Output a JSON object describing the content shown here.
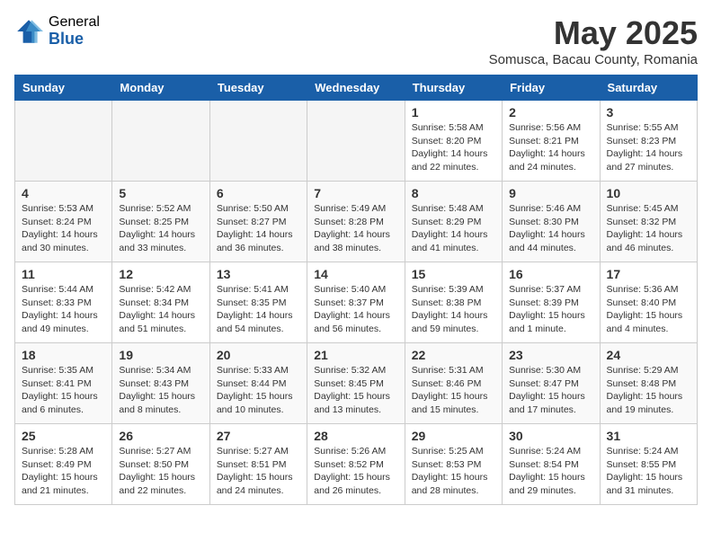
{
  "logo": {
    "general": "General",
    "blue": "Blue"
  },
  "title": {
    "month_year": "May 2025",
    "location": "Somusca, Bacau County, Romania"
  },
  "days_of_week": [
    "Sunday",
    "Monday",
    "Tuesday",
    "Wednesday",
    "Thursday",
    "Friday",
    "Saturday"
  ],
  "weeks": [
    [
      {
        "day": "",
        "info": ""
      },
      {
        "day": "",
        "info": ""
      },
      {
        "day": "",
        "info": ""
      },
      {
        "day": "",
        "info": ""
      },
      {
        "day": "1",
        "info": "Sunrise: 5:58 AM\nSunset: 8:20 PM\nDaylight: 14 hours\nand 22 minutes."
      },
      {
        "day": "2",
        "info": "Sunrise: 5:56 AM\nSunset: 8:21 PM\nDaylight: 14 hours\nand 24 minutes."
      },
      {
        "day": "3",
        "info": "Sunrise: 5:55 AM\nSunset: 8:23 PM\nDaylight: 14 hours\nand 27 minutes."
      }
    ],
    [
      {
        "day": "4",
        "info": "Sunrise: 5:53 AM\nSunset: 8:24 PM\nDaylight: 14 hours\nand 30 minutes."
      },
      {
        "day": "5",
        "info": "Sunrise: 5:52 AM\nSunset: 8:25 PM\nDaylight: 14 hours\nand 33 minutes."
      },
      {
        "day": "6",
        "info": "Sunrise: 5:50 AM\nSunset: 8:27 PM\nDaylight: 14 hours\nand 36 minutes."
      },
      {
        "day": "7",
        "info": "Sunrise: 5:49 AM\nSunset: 8:28 PM\nDaylight: 14 hours\nand 38 minutes."
      },
      {
        "day": "8",
        "info": "Sunrise: 5:48 AM\nSunset: 8:29 PM\nDaylight: 14 hours\nand 41 minutes."
      },
      {
        "day": "9",
        "info": "Sunrise: 5:46 AM\nSunset: 8:30 PM\nDaylight: 14 hours\nand 44 minutes."
      },
      {
        "day": "10",
        "info": "Sunrise: 5:45 AM\nSunset: 8:32 PM\nDaylight: 14 hours\nand 46 minutes."
      }
    ],
    [
      {
        "day": "11",
        "info": "Sunrise: 5:44 AM\nSunset: 8:33 PM\nDaylight: 14 hours\nand 49 minutes."
      },
      {
        "day": "12",
        "info": "Sunrise: 5:42 AM\nSunset: 8:34 PM\nDaylight: 14 hours\nand 51 minutes."
      },
      {
        "day": "13",
        "info": "Sunrise: 5:41 AM\nSunset: 8:35 PM\nDaylight: 14 hours\nand 54 minutes."
      },
      {
        "day": "14",
        "info": "Sunrise: 5:40 AM\nSunset: 8:37 PM\nDaylight: 14 hours\nand 56 minutes."
      },
      {
        "day": "15",
        "info": "Sunrise: 5:39 AM\nSunset: 8:38 PM\nDaylight: 14 hours\nand 59 minutes."
      },
      {
        "day": "16",
        "info": "Sunrise: 5:37 AM\nSunset: 8:39 PM\nDaylight: 15 hours\nand 1 minute."
      },
      {
        "day": "17",
        "info": "Sunrise: 5:36 AM\nSunset: 8:40 PM\nDaylight: 15 hours\nand 4 minutes."
      }
    ],
    [
      {
        "day": "18",
        "info": "Sunrise: 5:35 AM\nSunset: 8:41 PM\nDaylight: 15 hours\nand 6 minutes."
      },
      {
        "day": "19",
        "info": "Sunrise: 5:34 AM\nSunset: 8:43 PM\nDaylight: 15 hours\nand 8 minutes."
      },
      {
        "day": "20",
        "info": "Sunrise: 5:33 AM\nSunset: 8:44 PM\nDaylight: 15 hours\nand 10 minutes."
      },
      {
        "day": "21",
        "info": "Sunrise: 5:32 AM\nSunset: 8:45 PM\nDaylight: 15 hours\nand 13 minutes."
      },
      {
        "day": "22",
        "info": "Sunrise: 5:31 AM\nSunset: 8:46 PM\nDaylight: 15 hours\nand 15 minutes."
      },
      {
        "day": "23",
        "info": "Sunrise: 5:30 AM\nSunset: 8:47 PM\nDaylight: 15 hours\nand 17 minutes."
      },
      {
        "day": "24",
        "info": "Sunrise: 5:29 AM\nSunset: 8:48 PM\nDaylight: 15 hours\nand 19 minutes."
      }
    ],
    [
      {
        "day": "25",
        "info": "Sunrise: 5:28 AM\nSunset: 8:49 PM\nDaylight: 15 hours\nand 21 minutes."
      },
      {
        "day": "26",
        "info": "Sunrise: 5:27 AM\nSunset: 8:50 PM\nDaylight: 15 hours\nand 22 minutes."
      },
      {
        "day": "27",
        "info": "Sunrise: 5:27 AM\nSunset: 8:51 PM\nDaylight: 15 hours\nand 24 minutes."
      },
      {
        "day": "28",
        "info": "Sunrise: 5:26 AM\nSunset: 8:52 PM\nDaylight: 15 hours\nand 26 minutes."
      },
      {
        "day": "29",
        "info": "Sunrise: 5:25 AM\nSunset: 8:53 PM\nDaylight: 15 hours\nand 28 minutes."
      },
      {
        "day": "30",
        "info": "Sunrise: 5:24 AM\nSunset: 8:54 PM\nDaylight: 15 hours\nand 29 minutes."
      },
      {
        "day": "31",
        "info": "Sunrise: 5:24 AM\nSunset: 8:55 PM\nDaylight: 15 hours\nand 31 minutes."
      }
    ]
  ]
}
